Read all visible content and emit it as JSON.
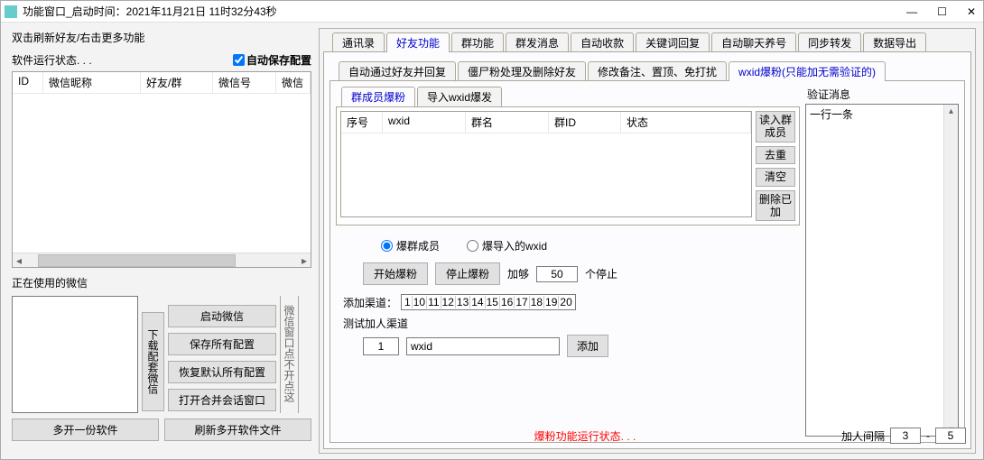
{
  "window": {
    "title": "功能窗口_启动时间：2021年11月21日 11时32分43秒",
    "min": "—",
    "max": "☐",
    "close": "✕"
  },
  "left": {
    "hint": "双击刷新好友/右击更多功能",
    "status": "软件运行状态. . .",
    "auto_save": "自动保存配置",
    "table_headers": {
      "id": "ID",
      "nick": "微信昵称",
      "rel": "好友/群",
      "wxh": "微信号",
      "wxi": "微信"
    },
    "using_label": "正在使用的微信",
    "dl_btn": "下载配套微信",
    "panel_tip": "微信窗口点不开点这",
    "btns": {
      "start": "启动微信",
      "saveall": "保存所有配置",
      "restore": "恢复默认所有配置",
      "merge": "打开合并会话窗口",
      "multi": "多开一份软件",
      "refresh": "刷新多开软件文件"
    }
  },
  "main_tabs": [
    "通讯录",
    "好友功能",
    "群功能",
    "群发消息",
    "自动收款",
    "关键词回复",
    "自动聊天养号",
    "同步转发",
    "数据导出"
  ],
  "sub_tabs": [
    "自动通过好友并回复",
    "僵尸粉处理及删除好友",
    "修改备注、置顶、免打扰",
    "wxid爆粉(只能加无需验证的)"
  ],
  "inner_tabs": [
    "群成员爆粉",
    "导入wxid爆发"
  ],
  "inner_headers": {
    "seq": "序号",
    "wxid": "wxid",
    "gname": "群名",
    "gid": "群ID",
    "state": "状态"
  },
  "side_btns": {
    "read": "读入群成员",
    "dedup": "去重",
    "clear": "清空",
    "del": "删除已加"
  },
  "verify": {
    "label": "验证消息",
    "hint": "一行一条"
  },
  "radios": {
    "a": "爆群成员",
    "b": "爆导入的wxid"
  },
  "ctrl": {
    "start": "开始爆粉",
    "stop": "停止爆粉",
    "label1": "加够",
    "val": "50",
    "label2": "个停止"
  },
  "channel": {
    "label": "添加渠道：",
    "items": [
      "1",
      "10",
      "11",
      "12",
      "13",
      "14",
      "15",
      "16",
      "17",
      "18",
      "19",
      "20"
    ]
  },
  "test": {
    "label": "测试加人渠道",
    "num": "1",
    "wxid": "wxid",
    "add": "添加"
  },
  "footer": {
    "status": "爆粉功能运行状态. . .",
    "interval_label": "加人间隔",
    "a": "3",
    "dash": "-",
    "b": "5"
  }
}
